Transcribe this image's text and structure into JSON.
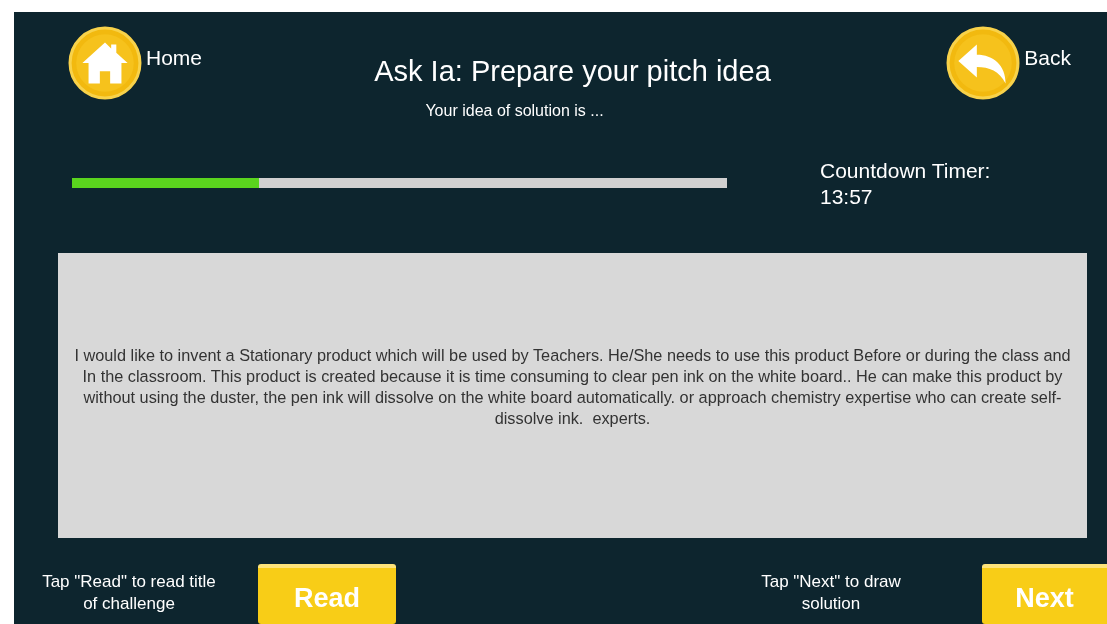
{
  "header": {
    "home": {
      "label": "Home"
    },
    "title": "Ask Ia: Prepare your pitch idea",
    "subtitle": "Your idea of solution is ...",
    "back": {
      "label": "Back"
    }
  },
  "progress": {
    "level": 0.285
  },
  "timer": {
    "label": "Countdown Timer:",
    "value": "13:57"
  },
  "idea_text": "I would like to invent a Stationary product which will be used by Teachers. He/She needs to use this product Before or during the class and In the classroom. This product is created because it is time consuming to clear pen ink on the white board.. He can make this product by without using the duster, the pen ink will dissolve on the white board automatically. or approach chemistry expertise who can create self-dissolve ink.  experts.",
  "footer": [
    {
      "hint": "Tap \"Read\" to read title of challenge",
      "button": "Read"
    },
    {
      "hint": "Tap \"Next\" to draw solution",
      "button": "Next"
    }
  ]
}
